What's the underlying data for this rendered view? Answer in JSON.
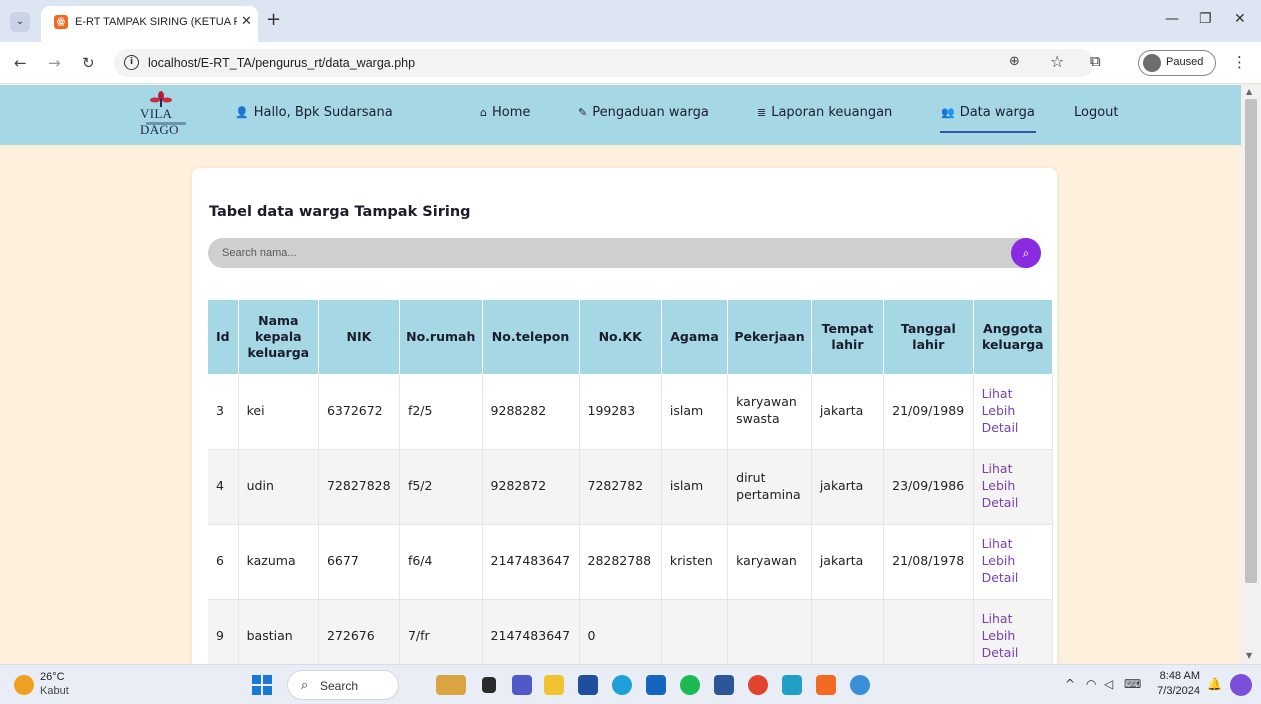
{
  "browser": {
    "tab_title": "E-RT TAMPAK SIRING (KETUA RT)",
    "url": "localhost/E-RT_TA/pengurus_rt/data_warga.php",
    "profile_status": "Paused"
  },
  "site_nav": {
    "logo_text": "VILA DAGO",
    "greeting": "Hallo, Bpk Sudarsana",
    "items": [
      {
        "label": "Home",
        "icon": "home-icon"
      },
      {
        "label": "Pengaduan warga",
        "icon": "edit-icon"
      },
      {
        "label": "Laporan keuangan",
        "icon": "database-icon"
      },
      {
        "label": "Data warga",
        "icon": "users-icon",
        "active": true
      },
      {
        "label": "Logout"
      }
    ]
  },
  "main": {
    "title": "Tabel data warga Tampak Siring",
    "search_placeholder": "Search nama...",
    "table": {
      "headers": [
        "Id",
        "Nama kepala keluarga",
        "NIK",
        "No.rumah",
        "No.telepon",
        "No.KK",
        "Agama",
        "Pekerjaan",
        "Tempat lahir",
        "Tanggal lahir",
        "Anggota keluarga"
      ],
      "rows": [
        {
          "id": "3",
          "nama": "kei",
          "nik": "6372672",
          "rumah": "f2/5",
          "telepon": "9288282",
          "kk": "199283",
          "agama": "islam",
          "pekerjaan": "karyawan swasta",
          "tempat": "jakarta",
          "tanggal": "21/09/1989",
          "link": "Lihat Lebih Detail"
        },
        {
          "id": "4",
          "nama": "udin",
          "nik": "72827828",
          "rumah": "f5/2",
          "telepon": "9282872",
          "kk": "7282782",
          "agama": "islam",
          "pekerjaan": "dirut pertamina",
          "tempat": "jakarta",
          "tanggal": "23/09/1986",
          "link": "Lihat Lebih Detail"
        },
        {
          "id": "6",
          "nama": "kazuma",
          "nik": "6677",
          "rumah": "f6/4",
          "telepon": "2147483647",
          "kk": "28282788",
          "agama": "kristen",
          "pekerjaan": "karyawan",
          "tempat": "jakarta",
          "tanggal": "21/08/1978",
          "link": "Lihat Lebih Detail"
        },
        {
          "id": "9",
          "nama": "bastian",
          "nik": "272676",
          "rumah": "7/fr",
          "telepon": "2147483647",
          "kk": "0",
          "agama": "",
          "pekerjaan": "",
          "tempat": "",
          "tanggal": "",
          "link": "Lihat Lebih Detail"
        }
      ]
    }
  },
  "taskbar": {
    "weather_temp": "26°C",
    "weather_desc": "Kabut",
    "search_label": "Search",
    "time": "8:48 AM",
    "date": "7/3/2024"
  },
  "colors": {
    "nav_bg": "#a6d7e4",
    "page_bg": "#fdf0dc",
    "search_button": "#8a2be2",
    "link": "#7a3fb0"
  }
}
